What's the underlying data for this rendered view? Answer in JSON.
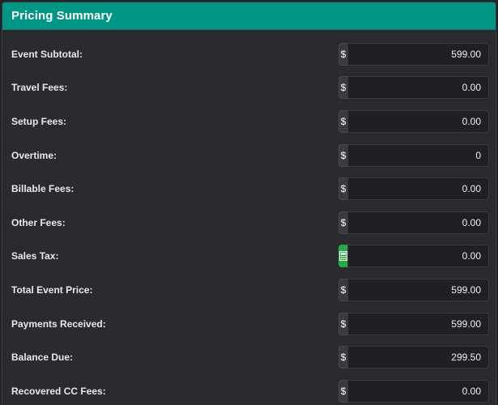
{
  "panel": {
    "title": "Pricing Summary",
    "header_color": "#009686"
  },
  "icons": {
    "currency": "dollar-sign-icon",
    "calculator": "calculator-icon"
  },
  "currency_symbol": "$",
  "rows": [
    {
      "label": "Event Subtotal:",
      "value": "599.00"
    },
    {
      "label": "Travel Fees:",
      "value": "0.00"
    },
    {
      "label": "Setup Fees:",
      "value": "0.00"
    },
    {
      "label": "Overtime:",
      "value": "0"
    },
    {
      "label": "Billable Fees:",
      "value": "0.00"
    },
    {
      "label": "Other Fees:",
      "value": "0.00"
    },
    {
      "label": "Sales Tax:",
      "value": "0.00"
    },
    {
      "label": "Total Event Price:",
      "value": "599.00"
    },
    {
      "label": "Payments Received:",
      "value": "599.00"
    },
    {
      "label": "Balance Due:",
      "value": "299.50"
    },
    {
      "label": "Recovered CC Fees:",
      "value": "0.00"
    }
  ]
}
